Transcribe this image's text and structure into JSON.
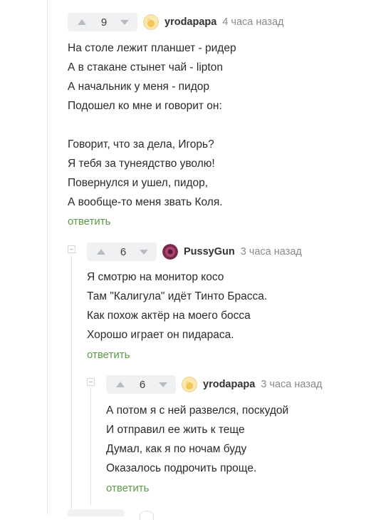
{
  "comments": [
    {
      "score": "9",
      "username": "yrodapapa",
      "time": "4 часа назад",
      "lines": [
        "На столе лежит планшет - ридер",
        "А в стакане стынет чай - lipton",
        "А начальник у меня - пидор",
        "Подошел ко мне и говорит он:",
        "",
        "Говорит, что за дела, Игорь?",
        "Я тебя за тунеядство уволю!",
        "Повернулся и ушел, пидор,",
        "А вообще-то меня звать Коля."
      ],
      "reply": "ответить"
    },
    {
      "score": "6",
      "username": "PussyGun",
      "time": "3 часа назад",
      "lines": [
        "Я смотрю на монитор косо",
        "Там \"Калигула\" идёт Тинто Брасса.",
        "Как похож актёр на моего босса",
        "Хорошо играет он пидараса."
      ],
      "reply": "ответить"
    },
    {
      "score": "6",
      "username": "yrodapapa",
      "time": "3 часа назад",
      "lines": [
        "А потом я с ней развелся, поскудой",
        "И отправил ее жить к теще",
        "Думал, как я по ночам буду",
        "Оказалось подрочить проще."
      ],
      "reply": "ответить"
    }
  ],
  "icons": {
    "upvote": "triangle-up-icon",
    "downvote": "chevron-down-icon",
    "collapse": "minus-box-icon"
  },
  "colors": {
    "reply_link": "#5b9a47",
    "vote_bg": "#f0f1f2",
    "time": "#8a8a8a"
  }
}
